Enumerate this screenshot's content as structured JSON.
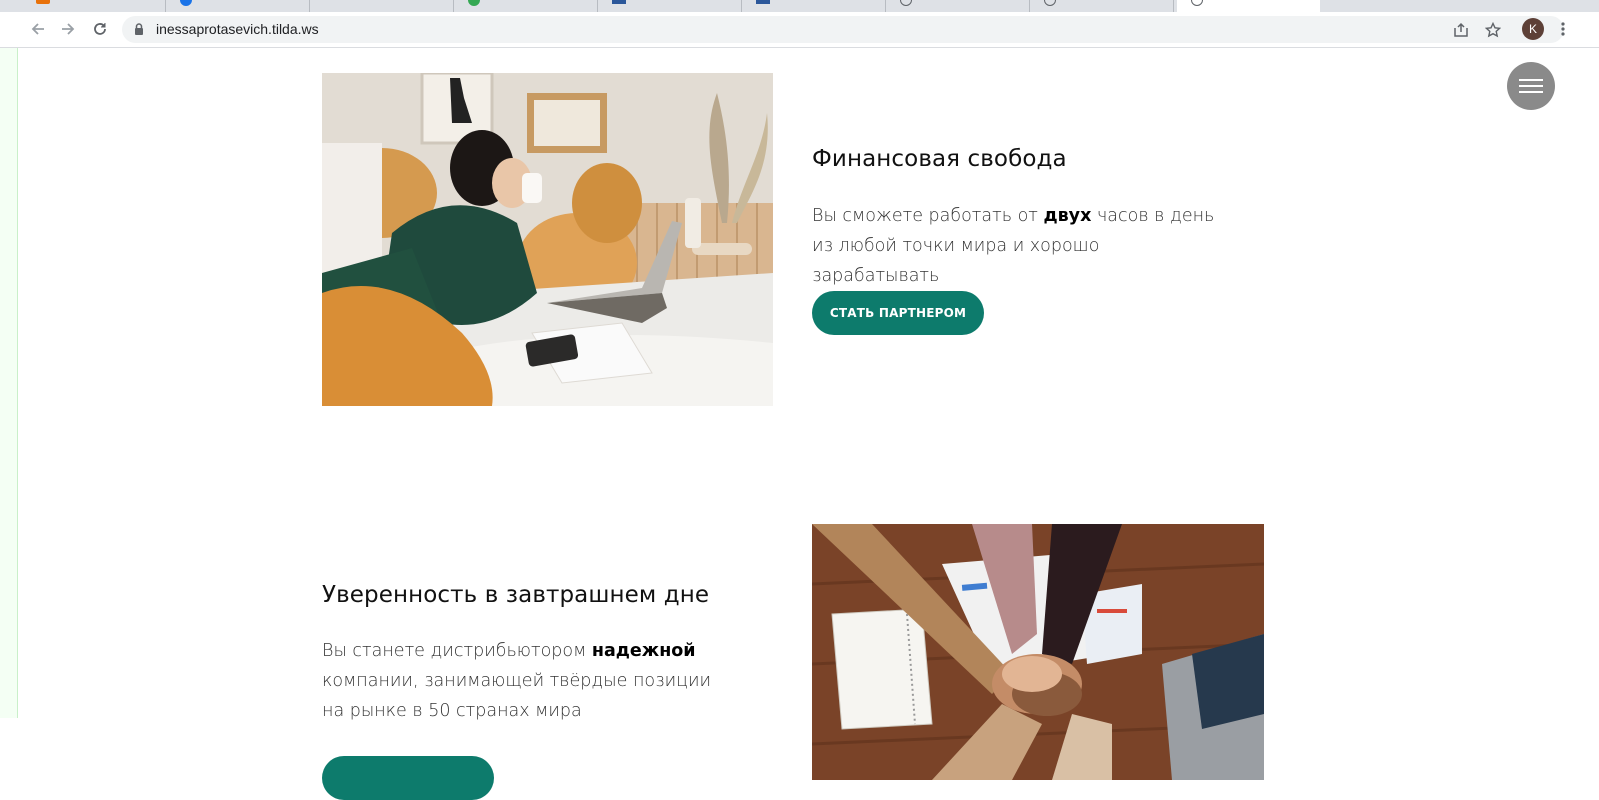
{
  "browser": {
    "url": "inessaprotasevich.tilda.ws",
    "profile_initial": "K"
  },
  "sections": [
    {
      "heading": "Финансовая свобода",
      "text_before": "Вы сможете работать от ",
      "text_bold": "двух",
      "text_after": " часов в день из любой точки мира и хорошо зарабатывать",
      "button_label": "СТАТЬ ПАРТНЕРОМ"
    },
    {
      "heading": "Уверенность в завтрашнем дне",
      "text_before": "Вы станете дистрибьютором ",
      "text_bold": "надежной",
      "text_after": " компании, занимающей твёрдые позиции на рынке в 50 странах мира",
      "button_label": ""
    }
  ],
  "colors": {
    "button_green": "#0d7b6c",
    "menu_button": "#8a8a8a",
    "chrome_tabstrip": "#dee1e6"
  },
  "icons": [
    "back-icon",
    "forward-icon",
    "reload-icon",
    "lock-icon",
    "share-icon",
    "star-icon",
    "kebab-menu-icon",
    "hamburger-icon"
  ]
}
